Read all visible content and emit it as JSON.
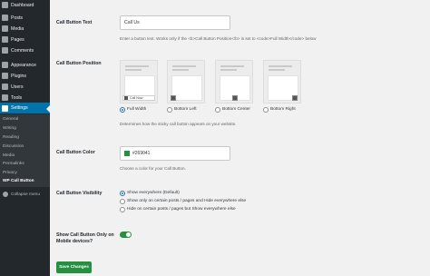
{
  "sidebar": {
    "items": [
      {
        "label": "Dashboard",
        "icon": "dashboard-icon"
      },
      {
        "label": "Posts",
        "icon": "pin-icon"
      },
      {
        "label": "Media",
        "icon": "media-icon"
      },
      {
        "label": "Pages",
        "icon": "pages-icon"
      },
      {
        "label": "Comments",
        "icon": "comments-icon"
      },
      {
        "label": "Appearance",
        "icon": "brush-icon"
      },
      {
        "label": "Plugins",
        "icon": "plugin-icon"
      },
      {
        "label": "Users",
        "icon": "users-icon"
      },
      {
        "label": "Tools",
        "icon": "wrench-icon"
      },
      {
        "label": "Settings",
        "icon": "settings-icon"
      }
    ],
    "submenu": [
      "General",
      "Writing",
      "Reading",
      "Discussion",
      "Media",
      "Permalinks",
      "Privacy",
      "WP Call Button"
    ],
    "collapse_label": "Collapse menu"
  },
  "fields": {
    "text": {
      "label": "Call Button Text",
      "value": "Call Us",
      "description": "Enter a button text. Works only if the <b>Call Button Position</b> is set to <code>Full Width</code> below"
    },
    "position": {
      "label": "Call Button Position",
      "options": [
        "Full Width",
        "Bottom Left",
        "Bottom Center",
        "Bottom Right"
      ],
      "selected": "Full Width",
      "preview_button_text": "Call Now",
      "description": "Determines how the sticky call button appears on your website."
    },
    "color": {
      "label": "Call Button Color",
      "value": "#269041",
      "swatch": "#269041",
      "description": "Choose a color for your Call Button."
    },
    "visibility": {
      "label": "Call Button Visibility",
      "options": [
        "Show everywhere (Default)",
        "Show only on certain posts / pages and Hide everywhere else",
        "Hide on certain posts / pages but Show everywhere else"
      ],
      "selected": "Show everywhere (Default)"
    },
    "mobile": {
      "label_line1": "Show Call Button Only on",
      "label_line2": "Mobile devices?",
      "enabled": true
    }
  },
  "save_label": "Save Changes",
  "colors": {
    "accent": "#269041",
    "menu_active": "#0073aa",
    "sidebar": "#23282d"
  }
}
